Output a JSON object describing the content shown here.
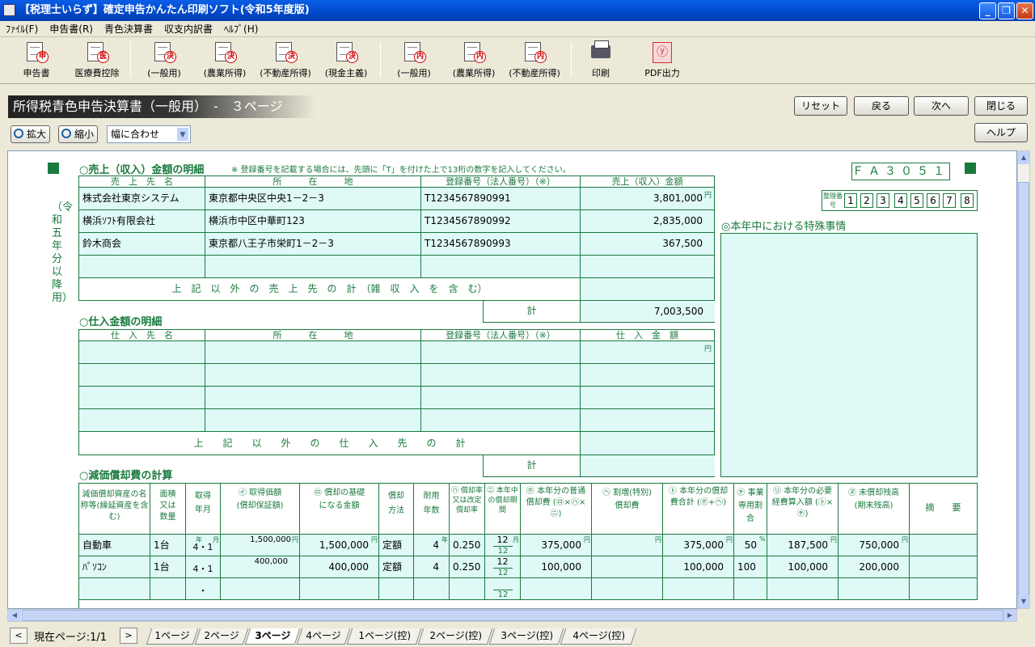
{
  "window": {
    "title": "【税理士いらず】確定申告かんたん印刷ソフト(令和5年度版)"
  },
  "menu": [
    "ﾌｧｲﾙ(F)",
    "申告書(R)",
    "青色決算書",
    "収支内訳書",
    "ﾍﾙﾌﾟ(H)"
  ],
  "toolbar": {
    "shinkokusho": {
      "label": "申告書",
      "stamp": "申"
    },
    "iryouhi": {
      "label": "医療費控除",
      "stamp": "医"
    },
    "ao_ippan": {
      "label": "(一般用)",
      "stamp": "決"
    },
    "ao_nougyou": {
      "label": "(農業所得)",
      "stamp": "決"
    },
    "ao_fudousan": {
      "label": "(不動産所得)",
      "stamp": "決"
    },
    "ao_genkin": {
      "label": "(現金主義)",
      "stamp": "決"
    },
    "uchi_ippan": {
      "label": "(一般用)",
      "stamp": "内"
    },
    "uchi_nougyou": {
      "label": "(農業所得)",
      "stamp": "内"
    },
    "uchi_fudousan": {
      "label": "(不動産所得)",
      "stamp": "内"
    },
    "print": {
      "label": "印刷"
    },
    "pdf": {
      "label": "PDF出力"
    }
  },
  "header": {
    "title": "所得税青色申告決算書（一般用）　-　３ページ"
  },
  "nav": {
    "reset": "リセット",
    "back": "戻る",
    "next": "次へ",
    "close": "閉じる",
    "help": "ヘルプ"
  },
  "zoom": {
    "in": "拡大",
    "out": "縮小",
    "select": "幅に合わせ"
  },
  "form": {
    "side_label": "（令和五年分以降用）",
    "code": "ＦＡ３０５１",
    "seiri_label": "整理番号",
    "seiri_digits": [
      "1",
      "2",
      "3",
      "4",
      "5",
      "6",
      "7",
      "8"
    ],
    "special": {
      "title": "◎本年中における特殊事情"
    },
    "sales": {
      "title": "○売上（収入）金額の明細",
      "note": "※ 登録番号を記載する場合には、先頭に「T」を付けた上で13桁の数字を記入してください。",
      "headers": [
        "売　上　先　名",
        "所　　　在　　　地",
        "登録番号（法人番号）（※）",
        "売上（収入）金額"
      ],
      "rows": [
        {
          "name": "株式会社東京システム",
          "address": "東京都中央区中央1－2－3",
          "reg": "T1234567890991",
          "amount": "3,801,000"
        },
        {
          "name": "横浜ｿﾌﾄ有限会社",
          "address": "横浜市中区中華町123",
          "reg": "T1234567890992",
          "amount": "2,835,000"
        },
        {
          "name": "鈴木商会",
          "address": "東京都八王子市栄町1－2－3",
          "reg": "T1234567890993",
          "amount": "367,500"
        },
        {
          "name": "",
          "address": "",
          "reg": "",
          "amount": ""
        }
      ],
      "other_label": "上　記　以　外　の　売　上　先　の　計　（雑　収　入　を　含　む）",
      "total_label": "計",
      "total": "7,003,500",
      "yen": "円"
    },
    "purchase": {
      "title": "○仕入金額の明細",
      "headers": [
        "仕　入　先　名",
        "所　　　在　　　地",
        "登録番号（法人番号）（※）",
        "仕　入　金　額"
      ],
      "other_label": "上　　記　　以　　外　　の　　仕　　入　　先　　の　　計",
      "total_label": "計",
      "yen": "円"
    },
    "dep": {
      "title": "○減価償却費の計算",
      "headers": [
        "減価償却資産の名称等(繰延資産を含む)",
        "面積又は数量",
        "取得年月",
        "㋑ 取得価額 (償却保証額)",
        "㋺ 償却の基礎になる金額",
        "償却方法",
        "耐用年数",
        "㋩ 償却率又は改定償却率",
        "㊁ 本年中の償却期間",
        "㋭ 本年分の普通償却費 (㋺×㋩×㊁)",
        "㋬ 割増(特別)償却費",
        "㋣ 本年分の償却費合計 (㋭+㋬)",
        "㋠ 事業専用割合",
        "㋷ 本年分の必要経費算入額 (㋣×㋠)",
        "㋦ 未償却残高 (期末残高)",
        "摘　　要"
      ],
      "rows": [
        {
          "name": "自動車",
          "qty": "1台",
          "date": "4・1",
          "acq": "1,500,000",
          "base": "1,500,000",
          "method": "定額",
          "life": "4",
          "rate": "0.250",
          "months": "12",
          "normal": "375,000",
          "extra": "",
          "total": "375,000",
          "ratio": "50",
          "expense": "187,500",
          "remain": "750,000",
          "note": ""
        },
        {
          "name": "ﾊﾟｿｺﾝ",
          "qty": "1台",
          "date": "4・1",
          "acq": "400,000",
          "base": "400,000",
          "method": "定額",
          "life": "4",
          "rate": "0.250",
          "months": "12",
          "normal": "100,000",
          "extra": "",
          "total": "100,000",
          "ratio": "100",
          "expense": "100,000",
          "remain": "200,000",
          "note": ""
        },
        {
          "name": "",
          "qty": "",
          "date": "・",
          "acq": "",
          "base": "",
          "method": "",
          "life": "",
          "rate": "",
          "months": "",
          "normal": "",
          "extra": "",
          "total": "",
          "ratio": "",
          "expense": "",
          "remain": "",
          "note": ""
        }
      ],
      "month_den": "12",
      "unit_year": "年",
      "unit_month": "月",
      "unit_yen": "円",
      "unit_pct": "%"
    }
  },
  "tabs": {
    "current": "現在ページ:1/1",
    "pages": [
      "1ページ",
      "2ページ",
      "3ページ",
      "4ページ",
      "1ページ(控)",
      "2ページ(控)",
      "3ページ(控)",
      "4ページ(控)"
    ]
  }
}
